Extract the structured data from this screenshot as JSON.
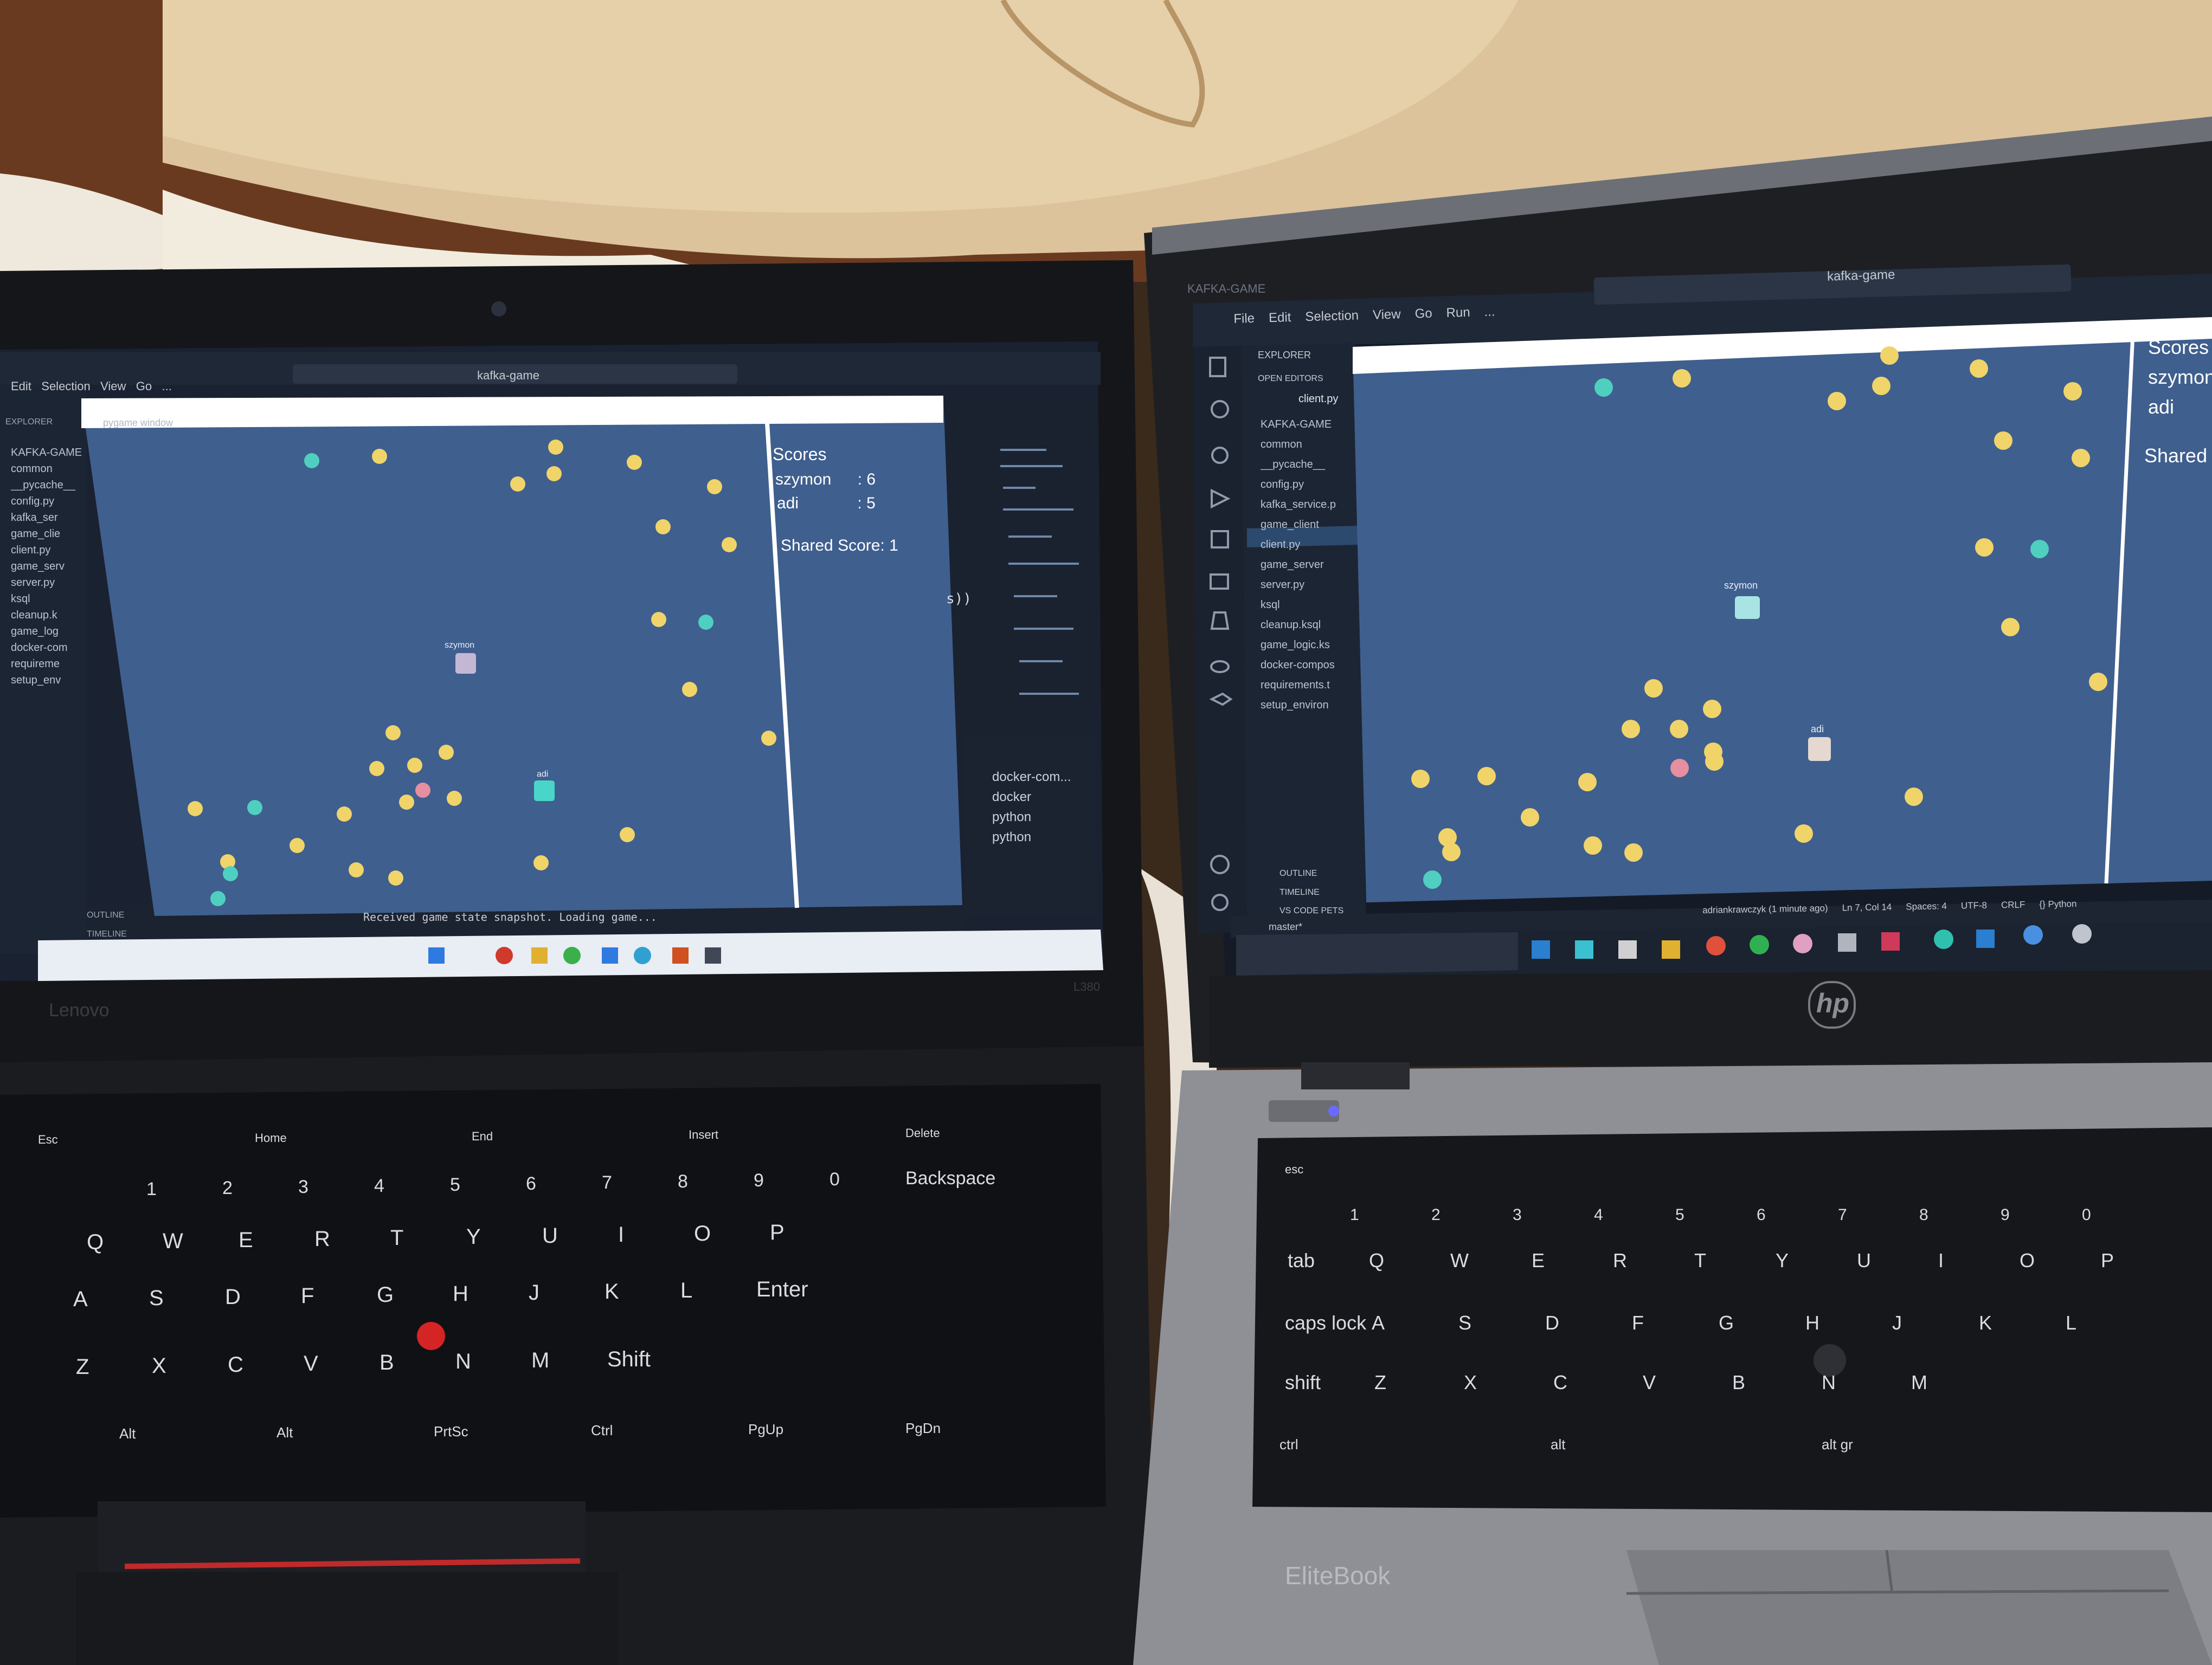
{
  "left_laptop": {
    "vscode": {
      "menu": [
        "Edit",
        "Selection",
        "View",
        "Go",
        "..."
      ],
      "search": "kafka-game",
      "explorer_title": "EXPLORER",
      "tree": [
        "KAFKA-GAME",
        "common",
        "__pycache__",
        "config.py",
        "kafka_ser",
        "game_clie",
        "client.py",
        "game_serv",
        "server.py",
        "ksql",
        "cleanup.k",
        "game_log",
        "docker-com",
        "requireme",
        "setup_env"
      ],
      "outline": "OUTLINE",
      "timeline": "TIMELINE",
      "terminal_line": "Received game state snapshot. Loading game...",
      "terminals": [
        "docker-com...",
        "docker",
        "python",
        "python"
      ],
      "code_fragment": "s))"
    },
    "game_window": {
      "title": "pygame window",
      "players": [
        {
          "name": "szymon",
          "color": "#c4b7d4"
        },
        {
          "name": "adi",
          "color": "#49d6c9"
        }
      ],
      "scores_title": "Scores",
      "scores": [
        {
          "name": "szymon",
          "sep": ":",
          "value": "6"
        },
        {
          "name": "adi",
          "sep": ":",
          "value": "5"
        }
      ],
      "shared_score_label": "Shared Score:",
      "shared_score_value": "1"
    },
    "brand": "Lenovo",
    "model": "L380",
    "keys": {
      "row_fn": [
        "Esc",
        "Home",
        "End",
        "Insert",
        "Delete"
      ],
      "row_num": [
        "1",
        "2",
        "3",
        "4",
        "5",
        "6",
        "7",
        "8",
        "9",
        "0",
        "Backspace"
      ],
      "row_q": [
        "Q",
        "W",
        "E",
        "R",
        "T",
        "Y",
        "U",
        "I",
        "O",
        "P"
      ],
      "row_a": [
        "A",
        "S",
        "D",
        "F",
        "G",
        "H",
        "J",
        "K",
        "L",
        "Enter"
      ],
      "row_z": [
        "Z",
        "X",
        "C",
        "V",
        "B",
        "N",
        "M",
        "Shift"
      ],
      "row_bottom": [
        "Alt",
        "Alt",
        "PrtSc",
        "Ctrl",
        "PgUp",
        "PgDn"
      ]
    }
  },
  "right_laptop": {
    "vscode": {
      "title_bar": "KAFKA-GAME",
      "menu": [
        "File",
        "Edit",
        "Selection",
        "View",
        "Go",
        "Run",
        "..."
      ],
      "search": "kafka-game",
      "explorer_title": "EXPLORER",
      "open_editors": "OPEN EDITORS",
      "open_file": "client.py",
      "tree": [
        "KAFKA-GAME",
        "common",
        "__pycache__",
        "config.py",
        "kafka_service.p",
        "game_client",
        "client.py",
        "game_server",
        "server.py",
        "ksql",
        "cleanup.ksql",
        "game_logic.ks",
        "docker-compos",
        "requirements.t",
        "setup_environ"
      ],
      "outline": "OUTLINE",
      "timeline": "TIMELINE",
      "vscode_pets": "VS CODE PETS",
      "status_left": "master*",
      "status_items": [
        "adriankrawczyk (1 minute ago)",
        "Ln 7, Col 14",
        "Spaces: 4",
        "UTF-8",
        "CRLF",
        "{} Python"
      ]
    },
    "game_window": {
      "players": [
        {
          "name": "szymon",
          "color": "#a9e4e4"
        },
        {
          "name": "adi",
          "color": "#e4d8d0"
        }
      ],
      "scores_title": "Scores",
      "scores": [
        "szymon",
        "adi"
      ],
      "shared_score_label": "Shared"
    },
    "brand_logo": "hp",
    "model": "EliteBook",
    "keys": {
      "row_fn": [
        "esc"
      ],
      "row_num": [
        "1",
        "2",
        "3",
        "4",
        "5",
        "6",
        "7",
        "8",
        "9",
        "0"
      ],
      "row_q": [
        "tab",
        "Q",
        "W",
        "E",
        "R",
        "T",
        "Y",
        "U",
        "I",
        "O",
        "P"
      ],
      "row_a": [
        "caps lock",
        "A",
        "S",
        "D",
        "F",
        "G",
        "H",
        "J",
        "K",
        "L"
      ],
      "row_z": [
        "shift",
        "Z",
        "X",
        "C",
        "V",
        "B",
        "N",
        "M"
      ],
      "row_bottom": [
        "ctrl",
        "alt",
        "alt gr"
      ]
    }
  },
  "colors": {
    "game_bg": "#3f5f8e",
    "coin_yellow": "#f0d46a",
    "coin_teal": "#4fcfc0",
    "coin_pink": "#e58fa0",
    "vscode_dark": "#1c2533"
  }
}
